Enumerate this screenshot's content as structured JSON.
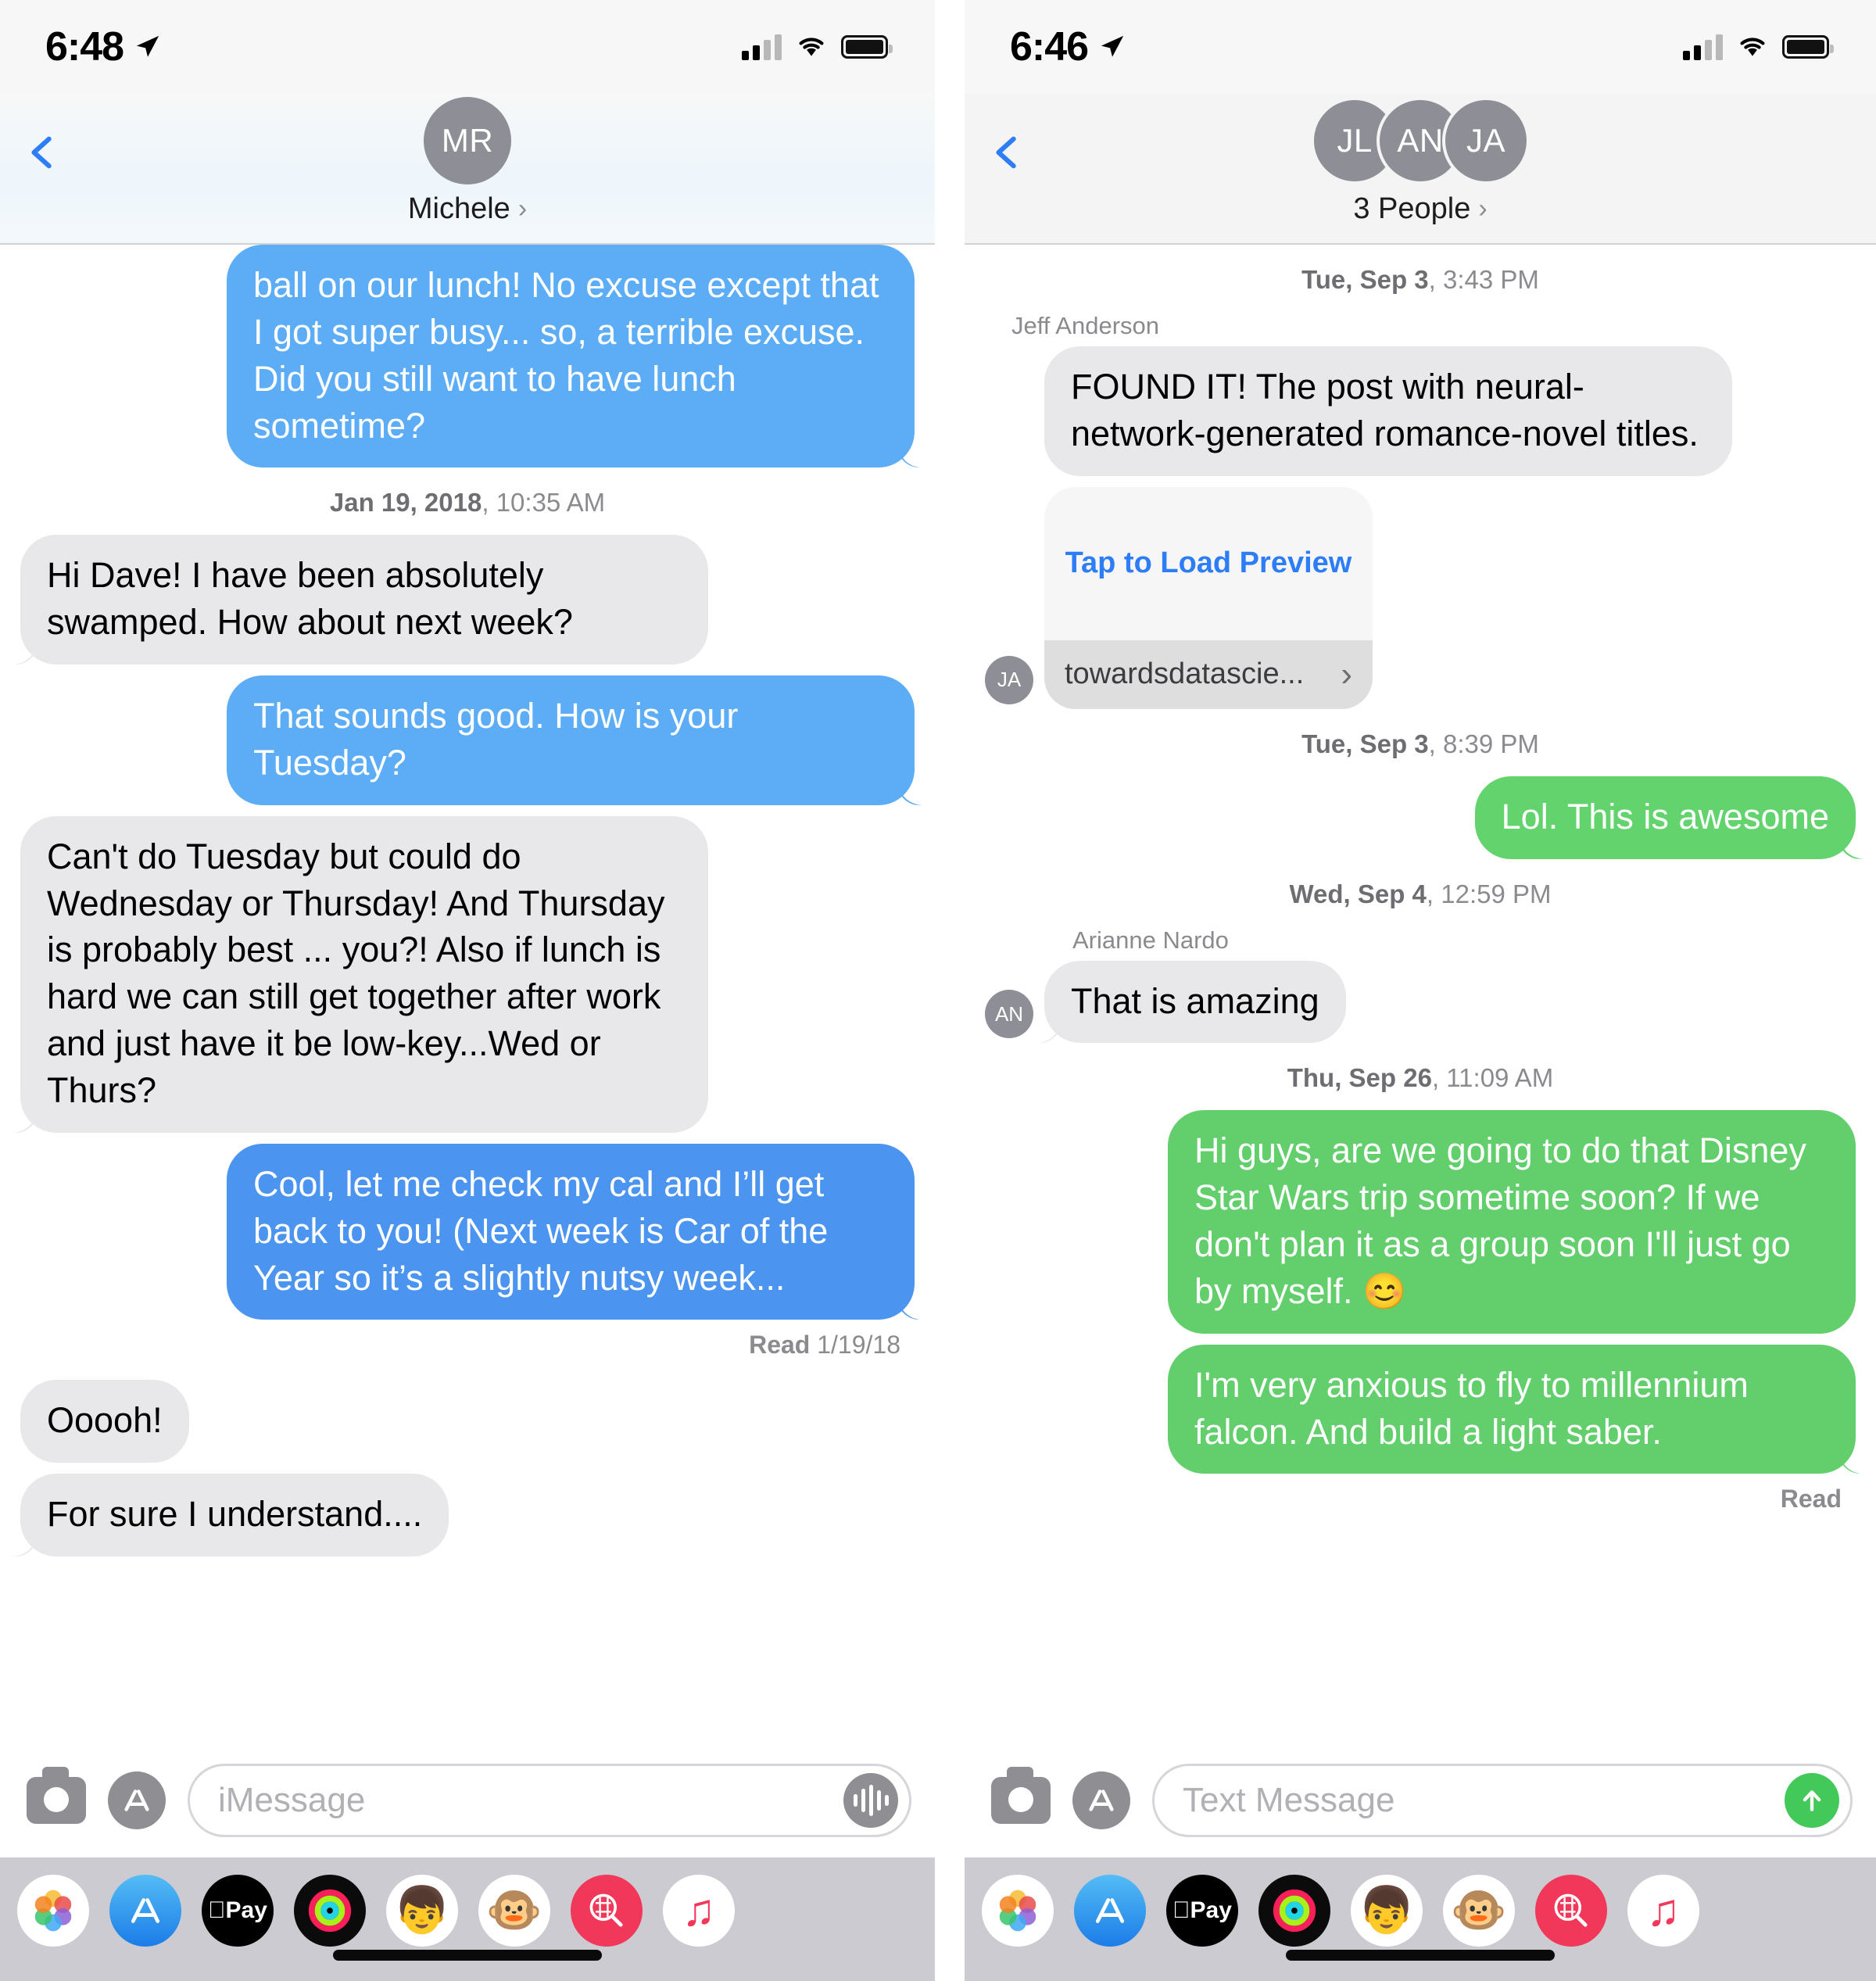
{
  "left_screen": {
    "status_bar": {
      "time": "6:48",
      "location_icon": "location-arrow-icon",
      "signal_icon": "cellular-signal-icon",
      "wifi_icon": "wifi-icon",
      "battery_icon": "battery-full-icon"
    },
    "nav": {
      "back_icon": "back-chevron-icon",
      "avatar_initials": "MR",
      "title": "Michele",
      "disclosure": "›"
    },
    "messages": [
      {
        "kind": "bubble",
        "side": "out",
        "style": "blue",
        "text": "ball on our lunch! No excuse except that I got super busy... so, a terrible excuse. Did you still want to have lunch sometime?"
      },
      {
        "kind": "timestamp",
        "date": "Jan 19, 2018",
        "time": "10:35 AM"
      },
      {
        "kind": "bubble",
        "side": "in",
        "style": "gray",
        "text": "Hi Dave! I have been absolutely swamped. How about next week?"
      },
      {
        "kind": "bubble",
        "side": "out",
        "style": "blue",
        "text": "That sounds good. How is your Tuesday?"
      },
      {
        "kind": "bubble",
        "side": "in",
        "style": "gray",
        "text": "Can't do Tuesday but could do Wednesday or Thursday! And Thursday is probably best ... you?! Also if lunch is hard we can still get together after work and just have it be low-key...Wed or Thurs?"
      },
      {
        "kind": "bubble",
        "side": "out",
        "style": "blue-dark",
        "text": "Cool, let me check my cal and I’ll get back to you! (Next week is Car of the Year so it’s a slightly nutsy week..."
      },
      {
        "kind": "delivery",
        "label": "Read",
        "value": "1/19/18"
      },
      {
        "kind": "bubble",
        "side": "in",
        "style": "gray",
        "text": "Ooooh!"
      },
      {
        "kind": "bubble",
        "side": "in",
        "style": "gray",
        "text": "For sure I understand...."
      }
    ],
    "composer": {
      "camera_icon": "camera-icon",
      "appstore_icon": "app-store-icon",
      "placeholder": "iMessage",
      "action_icon": "audio-waveform-icon"
    }
  },
  "right_screen": {
    "status_bar": {
      "time": "6:46",
      "location_icon": "location-arrow-icon",
      "signal_icon": "cellular-signal-icon",
      "wifi_icon": "wifi-icon",
      "battery_icon": "battery-full-icon"
    },
    "nav": {
      "back_icon": "back-chevron-icon",
      "avatars": [
        "JL",
        "AN",
        "JA"
      ],
      "title": "3 People",
      "disclosure": "›"
    },
    "messages": [
      {
        "kind": "timestamp",
        "date": "Tue, Sep 3",
        "time": "3:43 PM"
      },
      {
        "kind": "sender",
        "name": "Jeff Anderson"
      },
      {
        "kind": "bubble",
        "side": "in",
        "style": "gray",
        "text": "FOUND IT! The post with neural-network-generated romance-novel titles."
      },
      {
        "kind": "preview",
        "side": "in",
        "avatar": "JA",
        "link_label": "Tap to Load Preview",
        "url": "towardsdatascie...",
        "chevron": "›"
      },
      {
        "kind": "timestamp",
        "date": "Tue, Sep 3",
        "time": "8:39 PM"
      },
      {
        "kind": "bubble",
        "side": "out",
        "style": "green",
        "text": "Lol. This is awesome"
      },
      {
        "kind": "timestamp",
        "date": "Wed, Sep 4",
        "time": "12:59 PM"
      },
      {
        "kind": "sender",
        "name": "Arianne Nardo"
      },
      {
        "kind": "bubble",
        "side": "in",
        "style": "gray",
        "avatar": "AN",
        "text": "That is amazing"
      },
      {
        "kind": "timestamp",
        "date": "Thu, Sep 26",
        "time": "11:09 AM"
      },
      {
        "kind": "bubble",
        "side": "out",
        "style": "green-dark",
        "text": "Hi guys, are we going to do that Disney Star Wars trip sometime soon? If we don't plan it as a group soon I'll just go by myself. 😊"
      },
      {
        "kind": "bubble",
        "side": "out",
        "style": "green-dark",
        "text": "I'm very anxious to fly to millennium falcon. And build a light saber."
      },
      {
        "kind": "delivery",
        "label": "Read",
        "value": ""
      }
    ],
    "composer": {
      "camera_icon": "camera-icon",
      "appstore_icon": "app-store-icon",
      "placeholder": "Text Message",
      "action_icon": "send-arrow-up-icon"
    }
  },
  "app_drawer": {
    "items": [
      {
        "name": "photos-app-icon",
        "label": "Photos"
      },
      {
        "name": "app-store-app-icon",
        "label": "App Store"
      },
      {
        "name": "apple-pay-app-icon",
        "label": "Apple Pay"
      },
      {
        "name": "activity-app-icon",
        "label": "Activity"
      },
      {
        "name": "memoji-app-icon",
        "label": "Memoji Stickers"
      },
      {
        "name": "animoji-app-icon",
        "label": "Animoji"
      },
      {
        "name": "images-app-icon",
        "label": "#images"
      },
      {
        "name": "music-app-icon",
        "label": "Music"
      }
    ]
  },
  "colors": {
    "imessage_blue": "#5cadf6",
    "imessage_blue_dark": "#4b94ef",
    "sms_green": "#63d36d",
    "incoming_gray": "#e8e8ea",
    "link_blue": "#2d7df6",
    "send_green": "#43c85a",
    "drawer_bg": "#cbcbd1"
  }
}
